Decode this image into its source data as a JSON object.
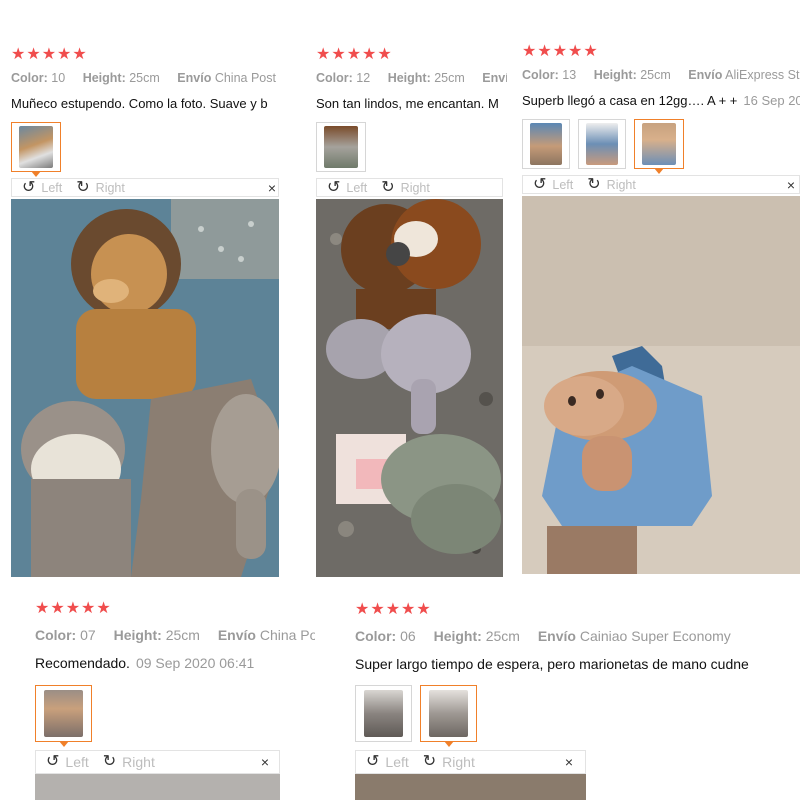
{
  "labels": {
    "color": "Color:",
    "height": "Height:",
    "envio": "Envío",
    "left": "Left",
    "right": "Right",
    "close": "×",
    "rotate_left_icon": "↺",
    "rotate_right_icon": "↻",
    "star": "★"
  },
  "reviews": [
    {
      "stars": 5,
      "color": "10",
      "height": "25cm",
      "envio": "China Post",
      "text": "Muñeco estupendo. Como la foto. Suave y b",
      "date": "",
      "thumbnails": [
        "lion-puppet-photo"
      ],
      "active_thumb": 0,
      "photo": "lion-sheep-elephant-puppets"
    },
    {
      "stars": 5,
      "color": "12",
      "height": "25cm",
      "envio": "",
      "text": "Son tan lindos, me encantan. M",
      "date": "",
      "thumbnails": [
        "puppets-pile-photo"
      ],
      "active_thumb": -1,
      "photo": "dog-elephant-hippo-puppets"
    },
    {
      "stars": 5,
      "color": "13",
      "height": "25cm",
      "envio": "AliExpress St",
      "text": "Superb llegó a casa en 12gg…. A + +",
      "date": "16 Sep 20",
      "thumbnails": [
        "donkey-photo-1",
        "donkey-photo-2",
        "donkey-photo-3"
      ],
      "active_thumb": 2,
      "photo": "donkey-puppet-on-hand"
    },
    {
      "stars": 5,
      "color": "07",
      "height": "25cm",
      "envio": "China Pos",
      "text": "Recomendado.",
      "date": "09 Sep 2020 06:41",
      "thumbnails": [
        "puppet-photo"
      ],
      "active_thumb": 0,
      "photo": ""
    },
    {
      "stars": 5,
      "color": "06",
      "height": "25cm",
      "envio": "Cainiao Super Economy",
      "text": "Super largo tiempo de espera, pero marionetas de mano cudne",
      "date": "",
      "thumbnails": [
        "sheep-photo-1",
        "sheep-photo-2"
      ],
      "active_thumb": 1,
      "photo": ""
    }
  ],
  "colors": {
    "star": "#f04d4d",
    "active_border": "#f0802a",
    "muted_text": "#9a9a9a"
  }
}
